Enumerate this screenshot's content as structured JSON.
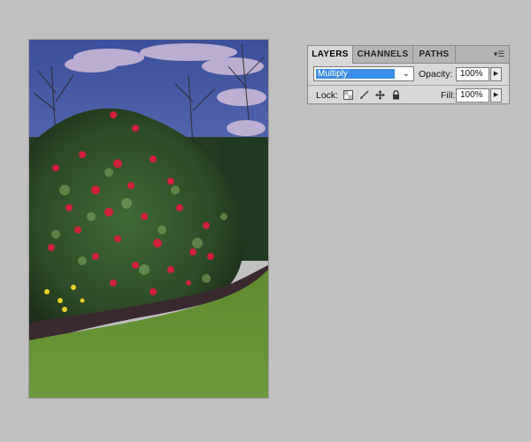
{
  "canvas": {
    "subject": "garden-photo",
    "blend_mode_applied": "Multiply"
  },
  "layers_panel": {
    "tabs": [
      {
        "label": "LAYERS",
        "active": true
      },
      {
        "label": "CHANNELS",
        "active": false
      },
      {
        "label": "PATHS",
        "active": false
      }
    ],
    "menu_icon": "panel-menu-icon",
    "blend_mode": "Multiply",
    "opacity_label": "Opacity:",
    "opacity_value": "100%",
    "lock_label": "Lock:",
    "lock_icons": [
      "lock-transparent-pixels-icon",
      "lock-image-pixels-icon",
      "lock-position-icon",
      "lock-all-icon"
    ],
    "fill_label": "Fill:",
    "fill_value": "100%"
  },
  "colors": {
    "background": "#c0c0c0",
    "panel": "#d8d8d8",
    "selection": "#3a8ee6",
    "flower_red": "#d0203a",
    "lawn_green": "#6f9a3a"
  }
}
